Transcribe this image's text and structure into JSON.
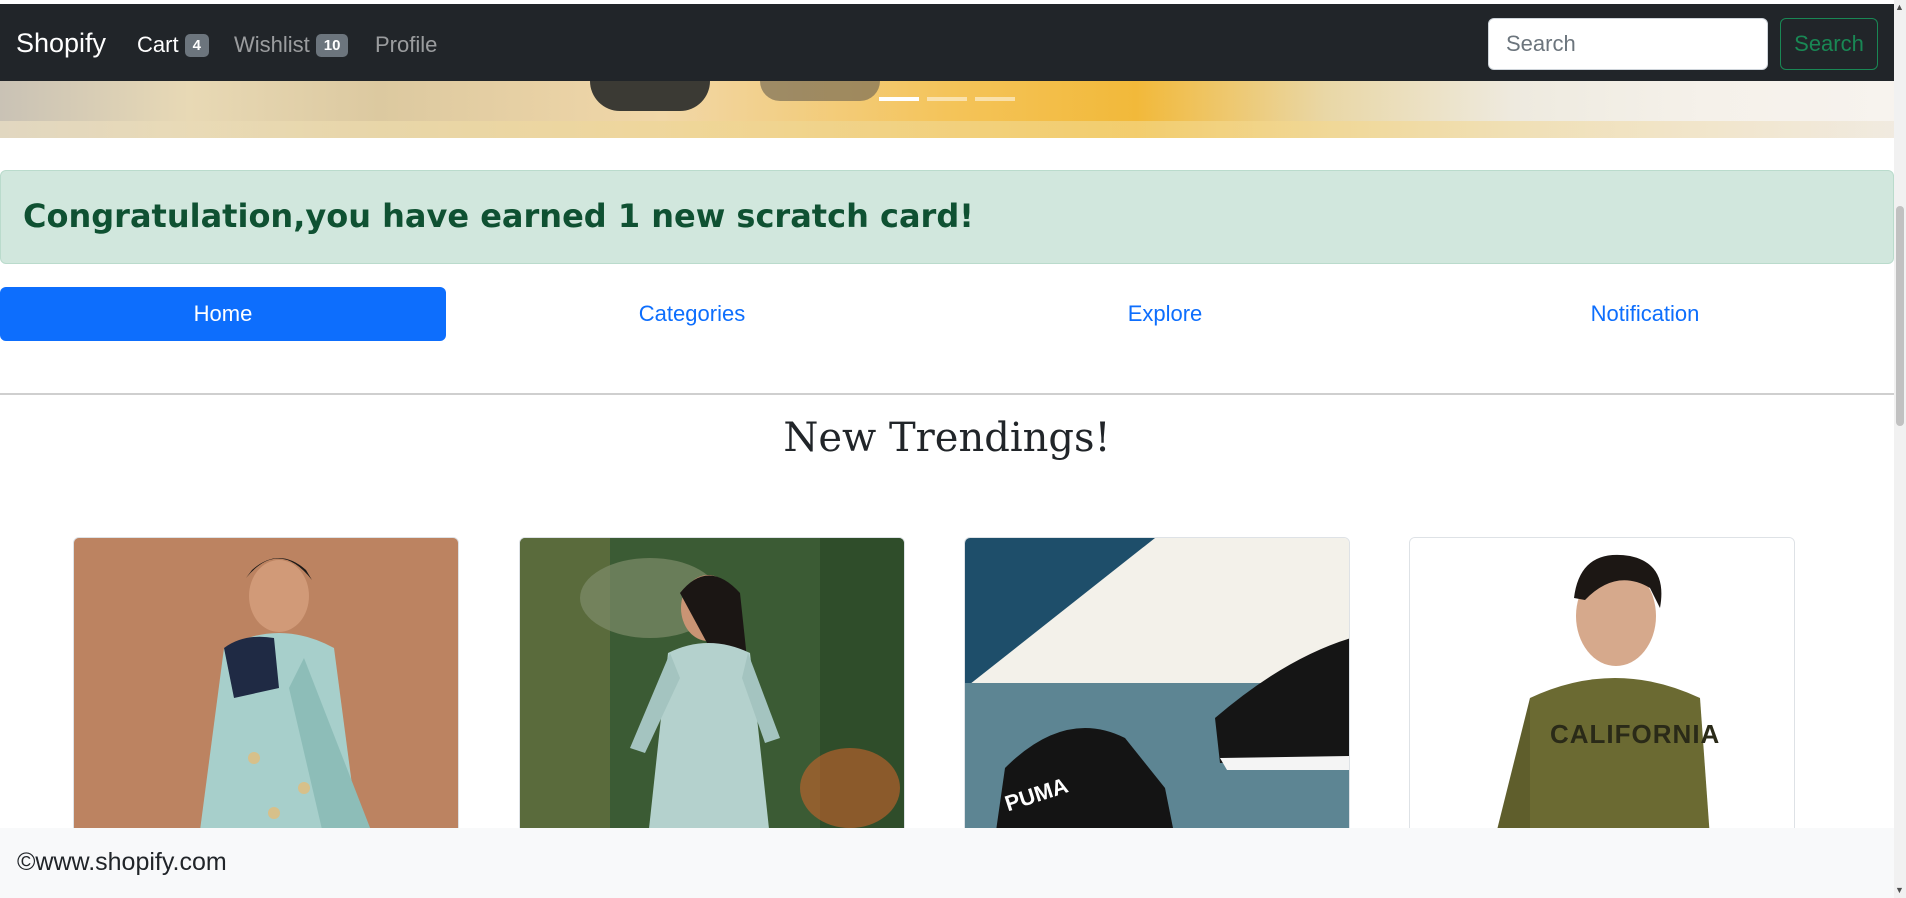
{
  "navbar": {
    "brand": "Shopify",
    "cart_label": "Cart",
    "cart_count": "4",
    "wishlist_label": "Wishlist",
    "wishlist_count": "10",
    "profile_label": "Profile",
    "search_placeholder": "Search",
    "search_button": "Search"
  },
  "carousel": {
    "active_slide": 1,
    "slide_count": 3
  },
  "alert": {
    "text": "Congratulation,you have earned 1 new scratch card!",
    "color": "#0f5132",
    "background": "#d1e7dd"
  },
  "tabs": [
    {
      "label": "Home",
      "active": true
    },
    {
      "label": "Categories",
      "active": false
    },
    {
      "label": "Explore",
      "active": false
    },
    {
      "label": "Notification",
      "active": false
    }
  ],
  "section": {
    "title": "New Trendings!"
  },
  "products": [
    {
      "image": "woman-in-saree-image"
    },
    {
      "image": "woman-in-kurta-image"
    },
    {
      "image": "puma-sneakers-image"
    },
    {
      "image": "man-in-california-sweatshirt-image"
    }
  ],
  "footer": {
    "text": "©www.shopify.com"
  },
  "colors": {
    "navbar": "#212529",
    "primary": "#0d6efd",
    "success": "#198754"
  }
}
